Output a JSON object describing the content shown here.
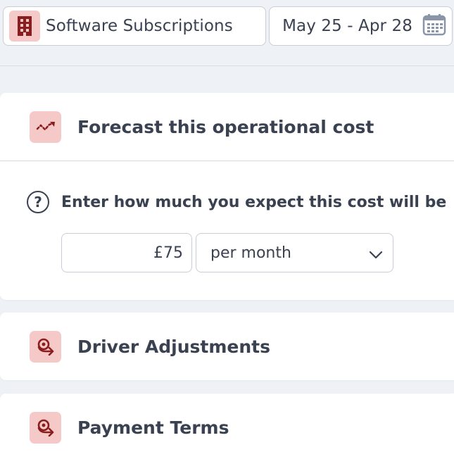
{
  "topbar": {
    "category": {
      "label": "Software Subscriptions",
      "icon": "building-icon"
    },
    "date_range": {
      "label": "May 25 - Apr 28",
      "icon": "calendar-icon"
    }
  },
  "forecast": {
    "title": "Forecast this operational cost",
    "icon": "trend-icon",
    "hint": "Enter how much you expect this cost will be",
    "amount": "£75",
    "period": {
      "selected": "per month"
    }
  },
  "sections": [
    {
      "title": "Driver Adjustments",
      "icon": "driver-icon"
    },
    {
      "title": "Payment Terms",
      "icon": "payment-icon"
    }
  ],
  "colors": {
    "accent_bg": "#f6c9c9",
    "accent_fg": "#8a1e1e",
    "text": "#3a4150",
    "page_bg": "#eef1f5"
  }
}
